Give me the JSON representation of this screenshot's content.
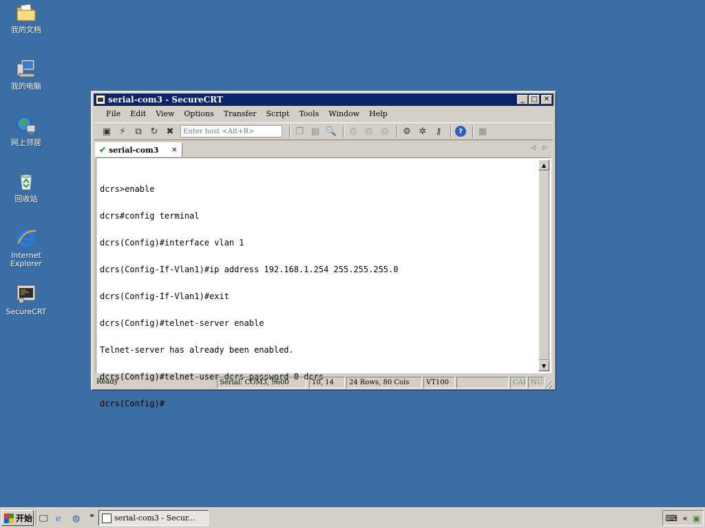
{
  "desktop": {
    "icons": [
      {
        "label": "我的文档",
        "icon": "folder-documents-icon"
      },
      {
        "label": "我的电脑",
        "icon": "computer-icon"
      },
      {
        "label": "网上邻居",
        "icon": "network-icon"
      },
      {
        "label": "回收站",
        "icon": "recycle-bin-icon"
      },
      {
        "label_line1": "Internet",
        "label_line2": "Explorer",
        "icon": "internet-explorer-icon"
      },
      {
        "label": "SecureCRT",
        "icon": "securecrt-icon"
      }
    ]
  },
  "window": {
    "title": "serial-com3 - SecureCRT",
    "controls": {
      "minimize": "_",
      "maximize": "□",
      "close": "✕"
    },
    "menu": [
      "File",
      "Edit",
      "View",
      "Options",
      "Transfer",
      "Script",
      "Tools",
      "Window",
      "Help"
    ],
    "toolbar": {
      "host_placeholder": "Enter host <Alt+R>",
      "icons": [
        "connect-icon",
        "quick-connect-icon",
        "connect-tab-icon",
        "reconnect-icon",
        "disconnect-icon",
        "copy-icon",
        "paste-icon",
        "find-icon",
        "print-icon",
        "print-selection-icon",
        "print-setup-icon",
        "session-options-icon",
        "global-options-icon",
        "keymap-icon",
        "help-icon",
        "sftp-icon"
      ]
    },
    "tab": {
      "label": "serial-com3",
      "close": "×"
    },
    "terminal_lines": [
      "dcrs>enable",
      "dcrs#config terminal",
      "dcrs(Config)#interface vlan 1",
      "dcrs(Config-If-Vlan1)#ip address 192.168.1.254 255.255.255.0",
      "dcrs(Config-If-Vlan1)#exit",
      "dcrs(Config)#telnet-server enable",
      "Telnet-server has already been enabled.",
      "dcrs(Config)#telnet-user dcrs password 0 dcrs",
      "dcrs(Config)#"
    ],
    "status": {
      "ready": "Ready",
      "serial": "Serial: COM3, 9600",
      "cursor": "10,  14",
      "size": "24 Rows, 80 Cols",
      "emulation": "VT100",
      "blank": "",
      "caps": "CAP",
      "num": "NUM"
    }
  },
  "taskbar": {
    "start_label": "开始",
    "task_label": "serial-com3 - Secur...",
    "chevron": "»",
    "tray_chevron": "«"
  }
}
